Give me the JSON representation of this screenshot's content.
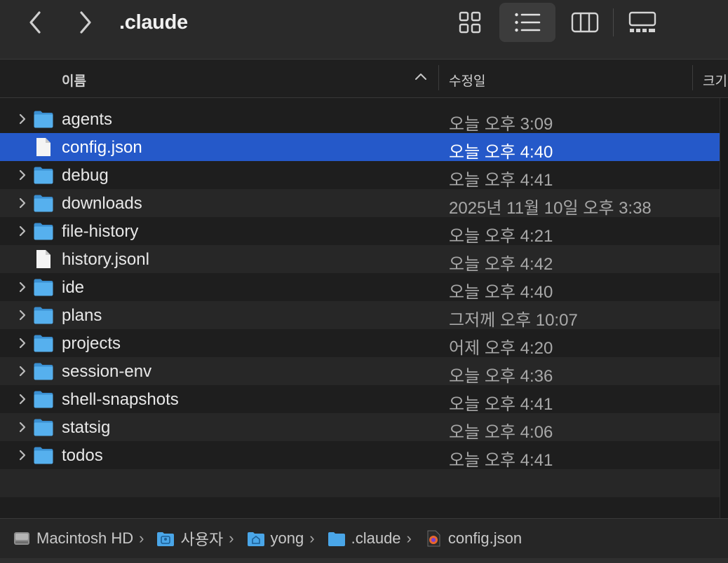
{
  "toolbar": {
    "title": ".claude",
    "back_icon": "chevron-left-icon",
    "forward_icon": "chevron-right-icon",
    "views": [
      {
        "name": "icon-view",
        "icon": "grid-icon",
        "selected": false
      },
      {
        "name": "list-view",
        "icon": "list-icon",
        "selected": true
      },
      {
        "name": "column-view",
        "icon": "columns-icon",
        "selected": false
      },
      {
        "name": "gallery-view",
        "icon": "gallery-icon",
        "selected": false
      }
    ]
  },
  "columns": {
    "name": "이름",
    "date": "수정일",
    "size": "크기",
    "sort": "ascending"
  },
  "files": [
    {
      "name": "agents",
      "date": "오늘 오후 3:09",
      "type": "folder",
      "selected": false
    },
    {
      "name": "config.json",
      "date": "오늘 오후 4:40",
      "type": "file",
      "selected": true
    },
    {
      "name": "debug",
      "date": "오늘 오후 4:41",
      "type": "folder",
      "selected": false
    },
    {
      "name": "downloads",
      "date": "2025년 11월 10일 오후 3:38",
      "type": "folder",
      "selected": false
    },
    {
      "name": "file-history",
      "date": "오늘 오후 4:21",
      "type": "folder",
      "selected": false
    },
    {
      "name": "history.jsonl",
      "date": "오늘 오후 4:42",
      "type": "file",
      "selected": false
    },
    {
      "name": "ide",
      "date": "오늘 오후 4:40",
      "type": "folder",
      "selected": false
    },
    {
      "name": "plans",
      "date": "그저께 오후 10:07",
      "type": "folder",
      "selected": false
    },
    {
      "name": "projects",
      "date": "어제 오후 4:20",
      "type": "folder",
      "selected": false
    },
    {
      "name": "session-env",
      "date": "오늘 오후 4:36",
      "type": "folder",
      "selected": false
    },
    {
      "name": "shell-snapshots",
      "date": "오늘 오후 4:41",
      "type": "folder",
      "selected": false
    },
    {
      "name": "statsig",
      "date": "오늘 오후 4:06",
      "type": "folder",
      "selected": false
    },
    {
      "name": "todos",
      "date": "오늘 오후 4:41",
      "type": "folder",
      "selected": false
    }
  ],
  "pathbar": [
    {
      "label": "Macintosh HD",
      "icon": "hard-drive-icon"
    },
    {
      "label": "사용자",
      "icon": "users-folder-icon"
    },
    {
      "label": "yong",
      "icon": "home-folder-icon"
    },
    {
      "label": ".claude",
      "icon": "folder-icon"
    },
    {
      "label": "config.json",
      "icon": "json-file-icon"
    }
  ],
  "colors": {
    "selection": "#2559c9",
    "folder": "#4aa6e8",
    "background": "#1e1e1e"
  }
}
